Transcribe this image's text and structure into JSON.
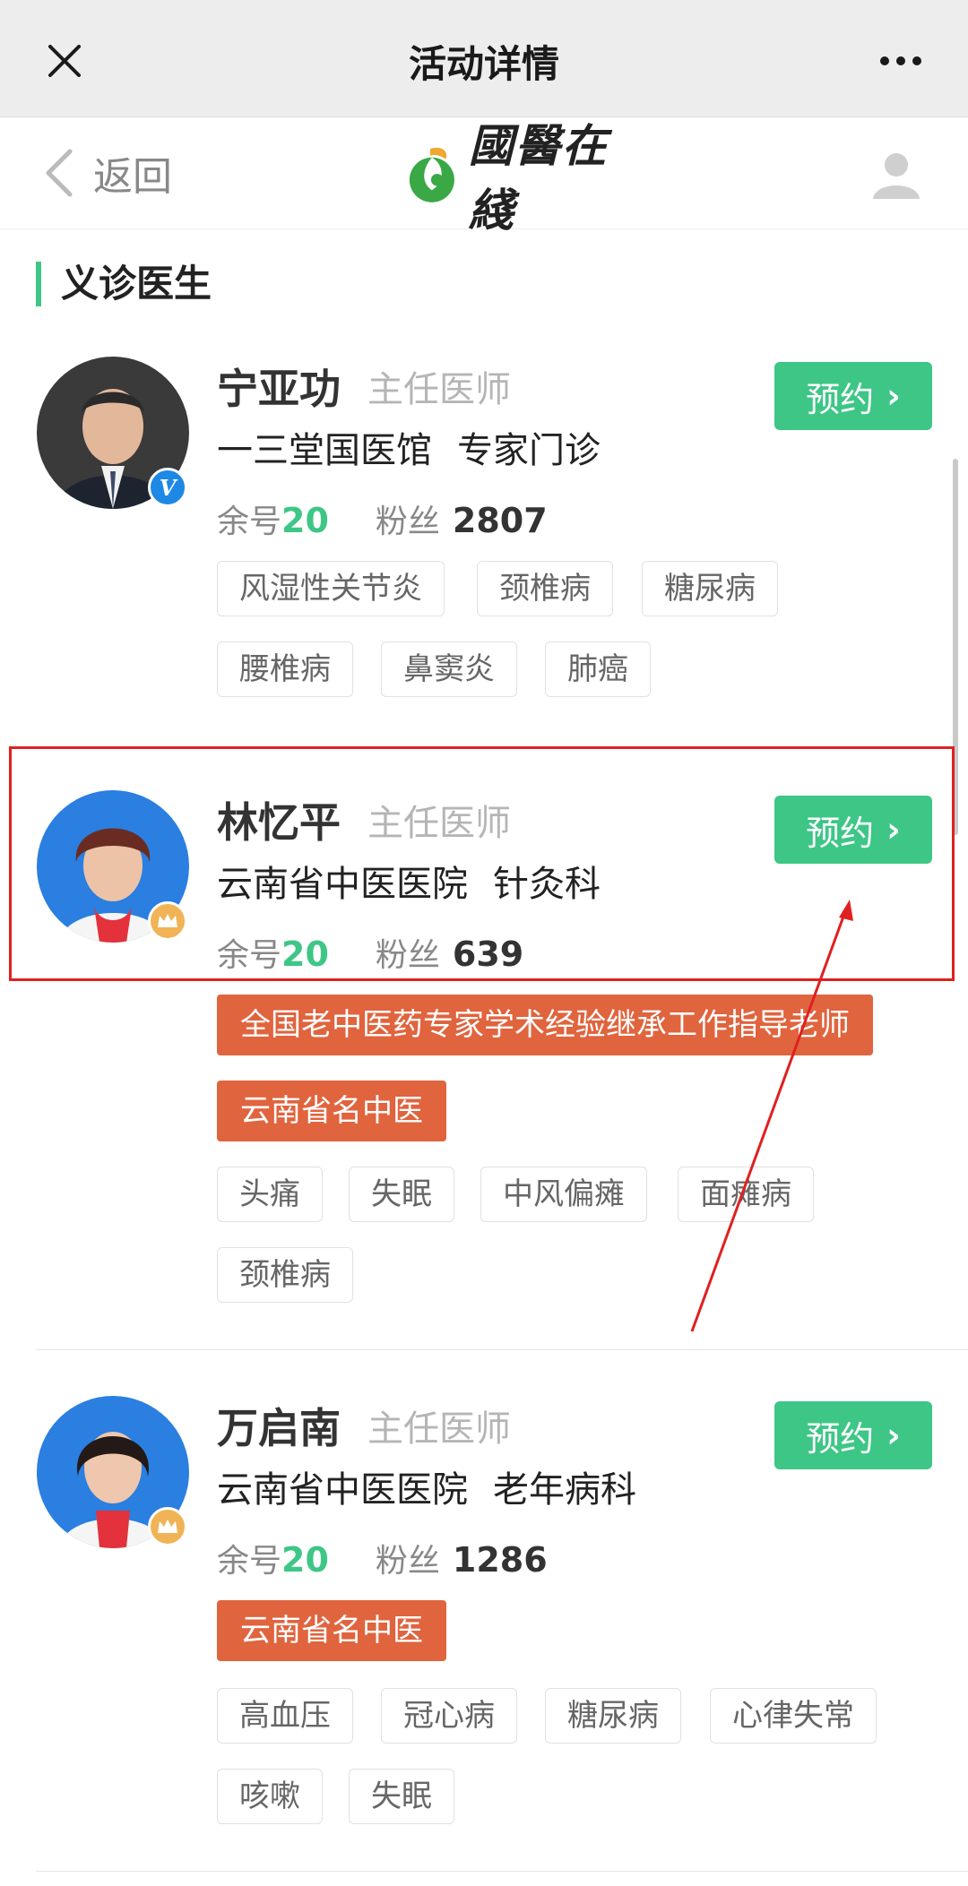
{
  "topbar": {
    "title": "活动详情"
  },
  "header": {
    "back_label": "返回",
    "logo_text": "國醫在綫"
  },
  "section": {
    "title": "义诊医生"
  },
  "doctors": [
    {
      "name": "宁亚功",
      "rank": "主任医师",
      "hospital": "一三堂国医馆",
      "department": "专家门诊",
      "remaining_label": "余号",
      "remaining": "20",
      "fans_label": "粉丝",
      "fans": "2807",
      "badge": "V",
      "book_label": "预约",
      "honors": [],
      "tags": [
        "风湿性关节炎",
        "颈椎病",
        "糖尿病",
        "腰椎病",
        "鼻窦炎",
        "肺癌"
      ]
    },
    {
      "name": "林忆平",
      "rank": "主任医师",
      "hospital": "云南省中医医院",
      "department": "针灸科",
      "remaining_label": "余号",
      "remaining": "20",
      "fans_label": "粉丝",
      "fans": "639",
      "badge": "crown",
      "book_label": "预约",
      "honors": [
        "全国老中医药专家学术经验继承工作指导老师",
        "云南省名中医"
      ],
      "tags": [
        "头痛",
        "失眠",
        "中风偏瘫",
        "面瘫病",
        "颈椎病"
      ]
    },
    {
      "name": "万启南",
      "rank": "主任医师",
      "hospital": "云南省中医医院",
      "department": "老年病科",
      "remaining_label": "余号",
      "remaining": "20",
      "fans_label": "粉丝",
      "fans": "1286",
      "badge": "crown",
      "book_label": "预约",
      "honors": [
        "云南省名中医"
      ],
      "tags": [
        "高血压",
        "冠心病",
        "糖尿病",
        "心律失常",
        "咳嗽",
        "失眠"
      ]
    }
  ],
  "colors": {
    "accent": "#3ec687",
    "honor": "#e0643e",
    "highlight": "#e02020",
    "verified": "#1e88e5",
    "crown": "#f0b456"
  }
}
